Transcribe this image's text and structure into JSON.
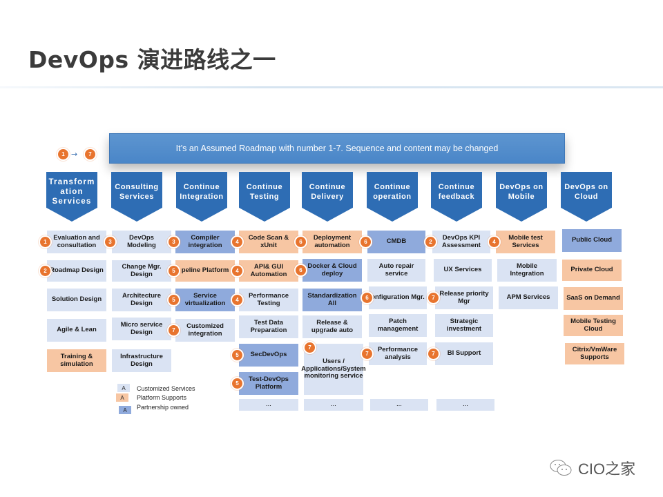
{
  "title": "DevOps 演进路线之一",
  "banner": "It’s an Assumed  Roadmap with number 1-7. Sequence and content may be changed",
  "sequence": {
    "from": "1",
    "to": "7"
  },
  "colors": {
    "header": "#2e6db4",
    "customized": "#dae3f3",
    "platform": "#f7c6a3",
    "partnership": "#8faadc",
    "badge": "#e8742e"
  },
  "columns": [
    {
      "label": "Transform ation Services"
    },
    {
      "label": "Consulting Services"
    },
    {
      "label": "Continue Integration"
    },
    {
      "label": "Continue Testing"
    },
    {
      "label": "Continue Delivery"
    },
    {
      "label": "Continue operation"
    },
    {
      "label": "Continue feedback"
    },
    {
      "label": "DevOps on Mobile"
    },
    {
      "label": "DevOps on Cloud"
    }
  ],
  "items": [
    {
      "col": 0,
      "text": "Evaluation and consultation",
      "type": "customized",
      "badge": "1"
    },
    {
      "col": 0,
      "text": "Roadmap Design",
      "type": "customized",
      "badge": "2"
    },
    {
      "col": 0,
      "text": "Solution Design",
      "type": "customized",
      "badge": ""
    },
    {
      "col": 0,
      "text": "Agile & Lean",
      "type": "customized",
      "badge": ""
    },
    {
      "col": 0,
      "text": "Training & simulation",
      "type": "platform",
      "badge": ""
    },
    {
      "col": 1,
      "text": "DevOps Modeling",
      "type": "customized",
      "badge": "3"
    },
    {
      "col": 1,
      "text": "Change Mgr. Design",
      "type": "customized",
      "badge": ""
    },
    {
      "col": 1,
      "text": "Architecture Design",
      "type": "customized",
      "badge": ""
    },
    {
      "col": 1,
      "text": "Micro service Design",
      "type": "customized",
      "badge": ""
    },
    {
      "col": 1,
      "text": "Infrastructure Design",
      "type": "customized",
      "badge": ""
    },
    {
      "col": 2,
      "text": "Compiler integration",
      "type": "partnership",
      "badge": "3"
    },
    {
      "col": 2,
      "text": "peline Platform",
      "type": "platform",
      "badge": "5"
    },
    {
      "col": 2,
      "text": "Service virtualization",
      "type": "partnership",
      "badge": "5"
    },
    {
      "col": 2,
      "text": "Customized integration",
      "type": "customized",
      "badge": "7"
    },
    {
      "col": 3,
      "text": "Code Scan & xUnit",
      "type": "platform",
      "badge": "4"
    },
    {
      "col": 3,
      "text": "API& GUI Automation",
      "type": "platform",
      "badge": "4"
    },
    {
      "col": 3,
      "text": "Performance Testing",
      "type": "customized",
      "badge": "4"
    },
    {
      "col": 3,
      "text": "Test Data Preparation",
      "type": "customized",
      "badge": ""
    },
    {
      "col": 3,
      "text": "SecDevOps",
      "type": "partnership",
      "badge": "5"
    },
    {
      "col": 3,
      "text": "Test-DevOps Platform",
      "type": "partnership",
      "badge": "5"
    },
    {
      "col": 3,
      "text": "...",
      "type": "customized",
      "badge": ""
    },
    {
      "col": 4,
      "text": "Deployment automation",
      "type": "platform",
      "badge": "6"
    },
    {
      "col": 4,
      "text": "Docker & Cloud deploy",
      "type": "partnership",
      "badge": "6"
    },
    {
      "col": 4,
      "text": "Standardization All",
      "type": "partnership",
      "badge": ""
    },
    {
      "col": 4,
      "text": "Release & upgrade auto",
      "type": "customized",
      "badge": ""
    },
    {
      "col": 4,
      "text": "Users / Applications/System monitoring service",
      "type": "customized",
      "badge": "7"
    },
    {
      "col": 4,
      "text": "...",
      "type": "customized",
      "badge": ""
    },
    {
      "col": 5,
      "text": "CMDB",
      "type": "partnership",
      "badge": "6"
    },
    {
      "col": 5,
      "text": "Auto repair service",
      "type": "customized",
      "badge": ""
    },
    {
      "col": 5,
      "text": "onfiguration Mgr.",
      "type": "customized",
      "badge": "6"
    },
    {
      "col": 5,
      "text": "Patch management",
      "type": "customized",
      "badge": ""
    },
    {
      "col": 5,
      "text": "Performance analysis",
      "type": "customized",
      "badge": "7"
    },
    {
      "col": 5,
      "text": "...",
      "type": "customized",
      "badge": ""
    },
    {
      "col": 6,
      "text": "DevOps KPI Assessment",
      "type": "customized",
      "badge": "2"
    },
    {
      "col": 6,
      "text": "UX Services",
      "type": "customized",
      "badge": ""
    },
    {
      "col": 6,
      "text": "Release priority Mgr",
      "type": "customized",
      "badge": "7"
    },
    {
      "col": 6,
      "text": "Strategic investment",
      "type": "customized",
      "badge": ""
    },
    {
      "col": 6,
      "text": "BI Support",
      "type": "customized",
      "badge": "7"
    },
    {
      "col": 6,
      "text": "...",
      "type": "customized",
      "badge": ""
    },
    {
      "col": 7,
      "text": "Mobile test Services",
      "type": "platform",
      "badge": "4"
    },
    {
      "col": 7,
      "text": "Mobile Integration",
      "type": "customized",
      "badge": ""
    },
    {
      "col": 7,
      "text": "APM Services",
      "type": "customized",
      "badge": ""
    },
    {
      "col": 8,
      "text": "Public Cloud",
      "type": "partnership",
      "badge": ""
    },
    {
      "col": 8,
      "text": "Private Cloud",
      "type": "platform",
      "badge": ""
    },
    {
      "col": 8,
      "text": "SaaS on Demand",
      "type": "platform",
      "badge": ""
    },
    {
      "col": 8,
      "text": "Mobile Testing Cloud",
      "type": "platform",
      "badge": ""
    },
    {
      "col": 8,
      "text": "Citrix/VmWare Supports",
      "type": "platform",
      "badge": ""
    }
  ],
  "legend": [
    {
      "swatch": "A",
      "label": "Customized Services",
      "type": "customized"
    },
    {
      "swatch": "A",
      "label": "Platform Supports",
      "type": "platform"
    },
    {
      "swatch": "A",
      "label": "Partnership owned",
      "type": "partnership"
    }
  ],
  "logo": {
    "text": "CIO之家"
  }
}
